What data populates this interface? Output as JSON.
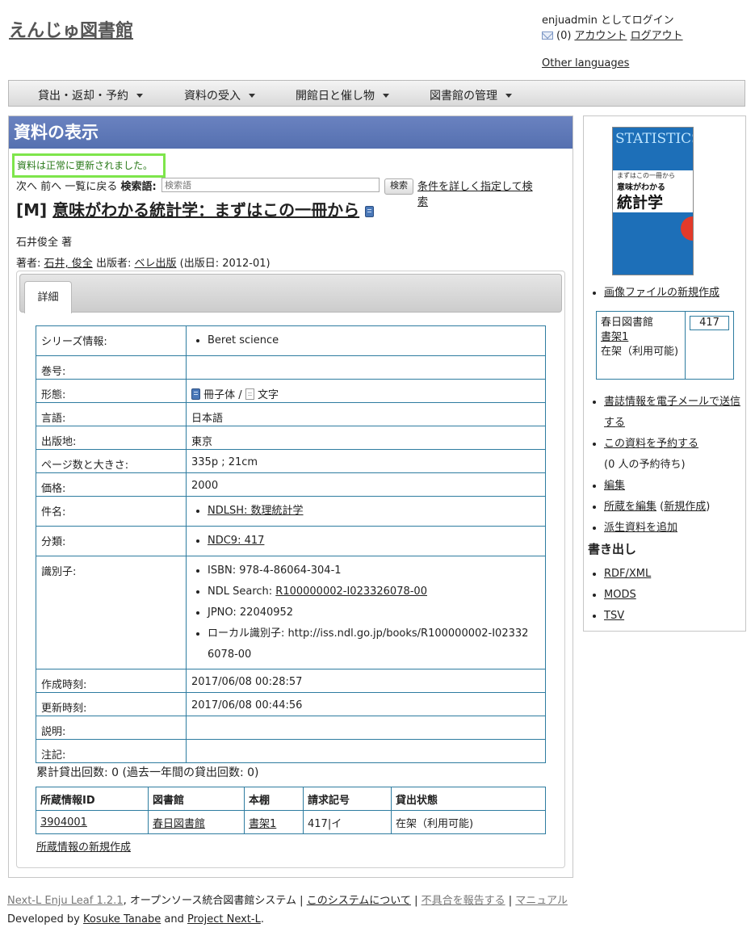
{
  "header": {
    "site_title": "えんじゅ図書館",
    "login_text": "enjuadmin としてログイン",
    "message_count": "(0)",
    "account_link": "アカウント",
    "logout_link": "ログアウト",
    "other_languages": "Other languages"
  },
  "menu": [
    {
      "label": "貸出・返却・予約"
    },
    {
      "label": "資料の受入"
    },
    {
      "label": "開館日と催し物"
    },
    {
      "label": "図書館の管理"
    }
  ],
  "main": {
    "title": "資料の表示",
    "notice": "資料は正常に更新されました。",
    "nav_next": "次へ",
    "nav_prev": "前へ",
    "nav_list": "一覧に戻る",
    "search_label": "検索語:",
    "search_placeholder": "検索語",
    "search_button": "検索",
    "advanced_search": "条件を詳しく指定して検索",
    "record_prefix": "[M]",
    "record_title": "意味がわかる統計学：まずはこの一冊から",
    "statement_of_responsibility": "石井俊全 著",
    "creators_label": "著者:",
    "creator_name": "石井, 俊全",
    "publisher_label": "出版者:",
    "publisher_name": "ベレ出版",
    "pub_date": "(出版日: 2012-01)",
    "tab_detail": "詳細"
  },
  "details": {
    "series_label": "シリーズ情報:",
    "series_value": "Beret science",
    "volume_label": "巻号:",
    "form_label": "形態:",
    "form_carrier": "冊子体",
    "form_sep": "/",
    "form_content": "文字",
    "language_label": "言語:",
    "language_value": "日本語",
    "place_label": "出版地:",
    "place_value": "東京",
    "extent_label": "ページ数と大きさ:",
    "extent_value": "335p ; 21cm",
    "price_label": "価格:",
    "price_value": "2000",
    "subject_label": "件名:",
    "subject_value": "NDLSH: 数理統計学",
    "classification_label": "分類:",
    "classification_value": "NDC9: 417",
    "identifier_label": "識別子:",
    "isbn": "ISBN: 978-4-86064-304-1",
    "ndl_search_prefix": "NDL Search:",
    "ndl_search_link": "R100000002-I023326078-00",
    "jpno": "JPNO: 22040952",
    "local_id_line1": "ローカル識別子: http://iss.ndl.go.jp/books/R100000002-I02332",
    "local_id_line2": "6078-00",
    "created_label": "作成時刻:",
    "created_value": "2017/06/08 00:28:57",
    "updated_label": "更新時刻:",
    "updated_value": "2017/06/08 00:44:56",
    "description_label": "説明:",
    "note_label": "注記:"
  },
  "loan_count": "累計貸出回数: 0 (過去一年間の貸出回数: 0)",
  "items": {
    "headers": [
      "所蔵情報ID",
      "図書館",
      "本棚",
      "請求記号",
      "貸出状態"
    ],
    "rows": [
      {
        "id": "3904001",
        "library": "春日図書館",
        "shelf": "書架1",
        "call_number": "417|イ",
        "status": "在架（利用可能)"
      }
    ],
    "new_item_link": "所蔵情報の新規作成"
  },
  "sidebar": {
    "cover": {
      "title_en": "STATISTICS",
      "subtitle": "まずはこの一冊から",
      "title_jp_small": "意味がわかる",
      "title_jp_large": "統計学"
    },
    "new_picture_link": "画像ファイルの新規作成",
    "holding_library": "春日図書館",
    "holding_shelf": "書架1",
    "holding_status": "在架（利用可能)",
    "holding_count": "417",
    "links": [
      {
        "label": "書誌情報を電子メールで送信する"
      },
      {
        "label": "この資料を予約する"
      },
      {
        "label": "(0 人の予約待ち)"
      },
      {
        "label": "編集"
      },
      {
        "label": "所蔵を編集"
      },
      {
        "label": "新規作成"
      },
      {
        "label": "派生資料を追加"
      }
    ],
    "export_title": "書き出し",
    "exports": [
      {
        "label": "RDF/XML"
      },
      {
        "label": "MODS"
      },
      {
        "label": "TSV"
      }
    ]
  },
  "footer": {
    "product_link": "Next-L Enju Leaf 1.2.1",
    "product_desc": ", オープンソース統合図書館システム",
    "sep": "|",
    "about_link": "このシステムについて",
    "bug_link": "不具合を報告する",
    "manual_link": "マニュアル",
    "developed_by": "Developed by",
    "author_link": "Kosuke Tanabe",
    "and": "and",
    "project_link": "Project Next-L",
    "period": "."
  }
}
